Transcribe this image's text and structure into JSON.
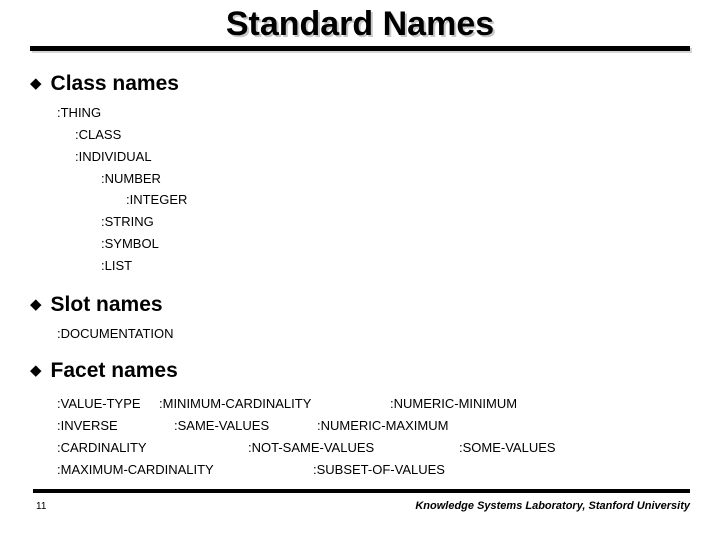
{
  "slide": {
    "title": "Standard Names",
    "bullet_glyph": "◆"
  },
  "sections": [
    {
      "heading": "Class names",
      "items": [
        {
          "label": ":THING",
          "level": 0
        },
        {
          "label": ":CLASS",
          "level": 1
        },
        {
          "label": ":INDIVIDUAL",
          "level": 1
        },
        {
          "label": ":NUMBER",
          "level": 2
        },
        {
          "label": ":INTEGER",
          "level": 3
        },
        {
          "label": ":STRING",
          "level": 2
        },
        {
          "label": ":SYMBOL",
          "level": 2
        },
        {
          "label": ":LIST",
          "level": 2
        }
      ]
    },
    {
      "heading": "Slot names",
      "items": [
        {
          "label": ":DOCUMENTATION",
          "level": 0
        }
      ]
    },
    {
      "heading": "Facet names",
      "rows": [
        [
          ":VALUE-TYPE",
          ":MINIMUM-CARDINALITY",
          ":NUMERIC-MINIMUM"
        ],
        [
          ":INVERSE",
          ":SAME-VALUES",
          ":NUMERIC-MAXIMUM"
        ],
        [
          ":CARDINALITY",
          ":NOT-SAME-VALUES",
          ":SOME-VALUES"
        ],
        [
          ":MAXIMUM-CARDINALITY",
          ":SUBSET-OF-VALUES"
        ]
      ]
    }
  ],
  "footer": {
    "page_number": "11",
    "credit": "Knowledge Systems Laboratory, Stanford University"
  }
}
